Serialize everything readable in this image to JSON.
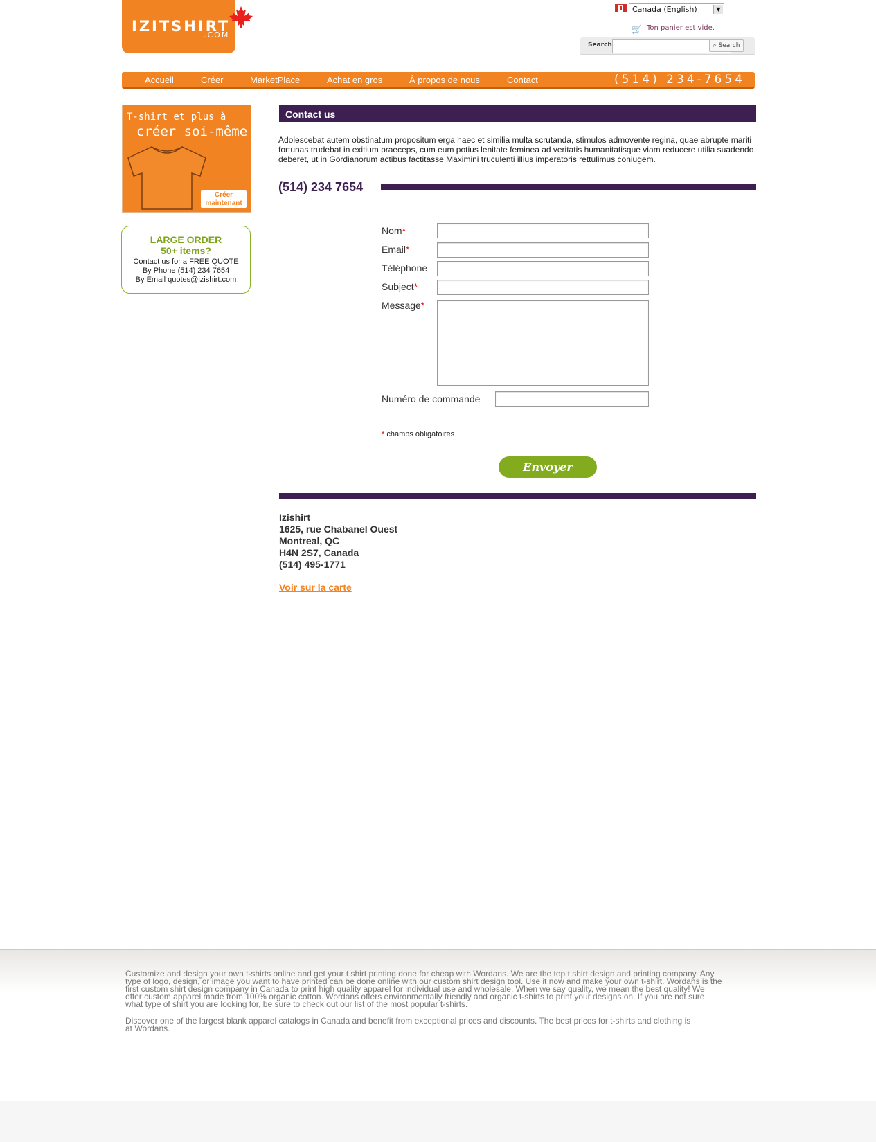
{
  "header": {
    "logo_text": "IZITSHIRT",
    "logo_sub": ".COM",
    "country_select": "Canada (English)",
    "cart_text": "Ton panier est vide.",
    "search_label": "Search:",
    "search_placeholder": "",
    "search_button": "Search"
  },
  "nav": {
    "items": [
      "Accueil",
      "Créer",
      "MarketPlace",
      "Achat en gros",
      "À propos de nous",
      "Contact"
    ],
    "phone": "(514) 234-7654"
  },
  "sidebar": {
    "promo_line1": "T-shirt et plus à",
    "promo_line2": "créer soi-même",
    "promo_button": "Créer maintenant",
    "order_title": "LARGE ORDER",
    "order_sub": "50+ items?",
    "order_lines": [
      "Contact us for a FREE QUOTE",
      "By Phone (514) 234 7654",
      "By Email  quotes@izishirt.com"
    ]
  },
  "main": {
    "title": "Contact us",
    "intro": "Adolescebat autem obstinatum propositum erga haec et similia multa scrutanda, stimulos admovente regina, quae abrupte mariti fortunas trudebat in exitium praeceps, cum eum potius lenitate feminea ad veritatis humanitatisque viam reducere utilia suadendo deberet, ut in Gordianorum actibus factitasse Maximini truculenti illius imperatoris rettulimus coniugem.",
    "phone": "(514) 234 7654",
    "form": {
      "nom": "Nom",
      "email": "Email",
      "telephone": "Téléphone",
      "subject": "Subject",
      "message": "Message",
      "order_number": "Numéro de commande",
      "required_mark": "*",
      "required_note": "champs obligatoires",
      "submit": "Envoyer"
    },
    "address": [
      "Izishirt",
      "1625, rue Chabanel Ouest",
      "Montreal, QC",
      "H4N 2S7, Canada",
      "(514) 495-1771"
    ],
    "map_link": "Voir sur la carte"
  },
  "footer": {
    "p1_lines": [
      "Customize and design your own t-shirts online and get your t shirt printing done for cheap with Wordans. We are the top t shirt design and printing company. Any",
      "type of logo, design, or image you want to have printed can be done online with our custom shirt design tool. Use it now and make your own t-shirt. Wordans is the",
      " first custom shirt design company in Canada to print high quality apparel for individual use and wholesale. When we say quality, we mean the best quality! We",
      "offer custom apparel made from 100% organic cotton. Wordans offers environmentally friendly and organic t-shirts to print your designs on. If you are not sure",
      "what type of shirt you are looking for, be sure to check out our list of the most popular t-shirts."
    ],
    "p2_lines": [
      "Discover one of the largest blank apparel catalogs in Canada and benefit from exceptional prices and discounts. The best prices for t-shirts and clothing is",
      "at Wordans."
    ]
  },
  "colors": {
    "brand_orange": "#f18322",
    "purple": "#3e1f52",
    "green": "#82ac1e"
  }
}
